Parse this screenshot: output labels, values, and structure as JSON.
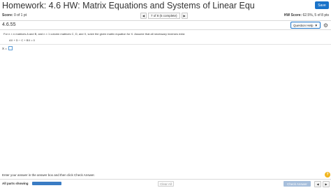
{
  "header": {
    "title": "Homework: 4.6 HW: Matrix Equations and Systems of Linear Equ",
    "save_label": "Save"
  },
  "score_bar": {
    "score_label": "Score:",
    "score_value": "0 of 1 pt",
    "nav_status": "7 of 8 (5 complete)",
    "prev_icon": "triangle-left-icon",
    "next_icon": "triangle-right-icon",
    "hw_score_label": "HW Score:",
    "hw_score_value": "62.5%, 5 of 8 pts"
  },
  "question": {
    "number": "4.6.55",
    "help_label": "Question Help",
    "instruction": "For n × n matrices A and B, and n × 1 column matrices C, D, and X, solve the given matrix equation for X. Assume that all necessary inverses exist.",
    "equation": "AX + D − C + BX = 0",
    "answer_label": "X =",
    "answer_value": ""
  },
  "footer": {
    "hint": "Enter your answer in the answer box and then click Check Answer.",
    "parts_label": "All parts showing",
    "progress_fraction": 1.0,
    "clear_label": "Clear All",
    "check_label": "Check Answer"
  },
  "colors": {
    "accent": "#1a73c9",
    "help_icon": "#f1b51c"
  }
}
